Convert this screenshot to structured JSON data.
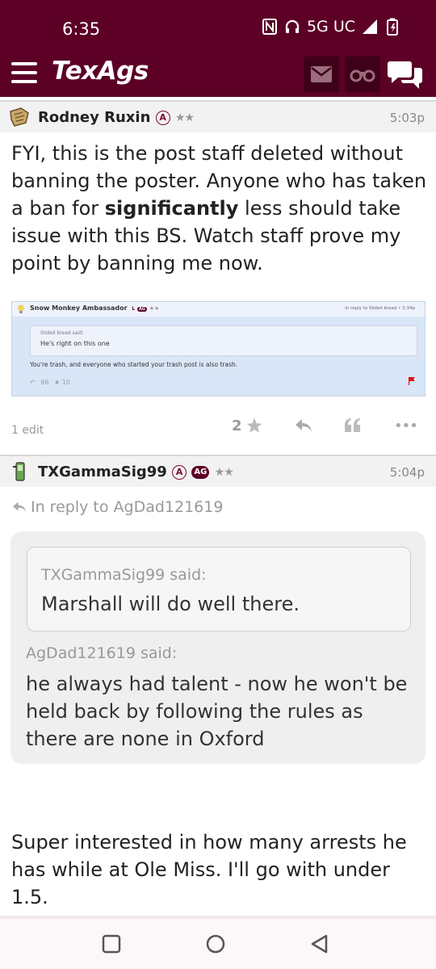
{
  "status_bar": {
    "time": "6:35",
    "network": "5G UC"
  },
  "header": {
    "logo": "TexAgs",
    "icons": {
      "menu": "hamburger-icon",
      "mail": "mail-icon",
      "binoculars": "binoculars-icon",
      "chat": "chat-bubbles-icon"
    },
    "colors": {
      "brand": "#5c0026",
      "button_bg": "#3f0019"
    }
  },
  "posts": [
    {
      "username": "Rodney Ruxin",
      "badge": "A",
      "stars": "★★",
      "time": "5:03p",
      "body": "FYI, this is the post staff deleted without banning the poster. Anyone who has taken a ban for ",
      "body_bold": "significantly",
      "body_after": " less should take issue with this BS. Watch staff prove my point by banning me now.",
      "embed": {
        "username": "Snow Monkey Ambassador",
        "badge": "L",
        "badge2": "AG",
        "stars": "★★",
        "reply_info": "In reply to Slided bread • 3:34p",
        "quote_name": "Slided bread said:",
        "quote_text": "He's right on this one",
        "text": "You're trash, and everyone who started your trash post is also trash.",
        "likes": "10",
        "quote_glyph": "66",
        "star_glyph": "★"
      },
      "edit_label": "1 edit",
      "like_count": "2",
      "actions": {
        "more": "•••"
      }
    },
    {
      "username": "TXGammaSig99",
      "badge": "A",
      "badge2": "AG",
      "stars": "★★",
      "time": "5:04p",
      "in_reply_to": "In reply to AgDad121619",
      "nested_quote_name": "TXGammaSig99 said:",
      "nested_quote_text": "Marshall will do well there.",
      "quote_name": "AgDad121619 said:",
      "quote_text": "he always had talent - now he won't be held back by following the rules as there are none in Oxford",
      "body": "Super interested in how many arrests he has while at Ole Miss. I'll go with under 1.5."
    }
  ],
  "nav": {
    "icons": [
      "recents-square-icon",
      "home-circle-icon",
      "back-triangle-icon"
    ]
  }
}
